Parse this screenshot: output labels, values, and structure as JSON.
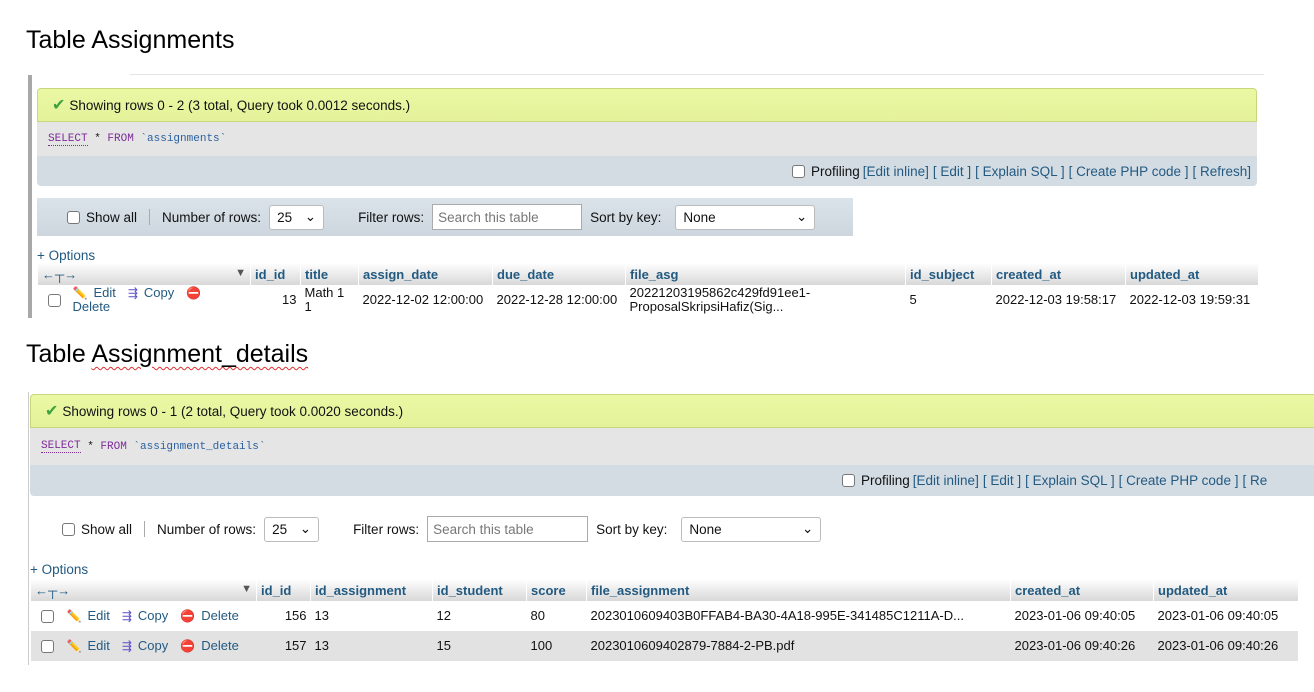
{
  "sections": [
    {
      "title": "Table Assignments",
      "success": "Showing rows 0 - 2 (3 total, Query took 0.0012 seconds.)",
      "sql": {
        "select": "SELECT",
        "star": " * ",
        "from": "FROM",
        "table": " `assignments`"
      },
      "columns": [
        "id_id",
        "title",
        "assign_date",
        "due_date",
        "file_asg",
        "id_subject",
        "created_at",
        "updated_at"
      ],
      "rows": [
        [
          "13",
          "Math 1 1",
          "2022-12-02 12:00:00",
          "2022-12-28 12:00:00",
          "20221203195862c429fd91ee1-ProposalSkripsiHafiz(Sig...",
          "5",
          "2022-12-03 19:58:17",
          "2022-12-03 19:59:31"
        ]
      ]
    },
    {
      "title_a": "Table ",
      "title_b": "Assignment_details",
      "success": "Showing rows 0 - 1 (2 total, Query took 0.0020 seconds.)",
      "sql": {
        "select": "SELECT",
        "star": " * ",
        "from": "FROM",
        "table": " `assignment_details`"
      },
      "columns": [
        "id_id",
        "id_assignment",
        "id_student",
        "score",
        "file_assignment",
        "created_at",
        "updated_at"
      ],
      "rows": [
        [
          "156",
          "13",
          "12",
          "80",
          "2023010609403B0FFAB4-BA30-4A18-995E-341485C1211A-D...",
          "2023-01-06 09:40:05",
          "2023-01-06 09:40:05"
        ],
        [
          "157",
          "13",
          "15",
          "100",
          "2023010609402879-7884-2-PB.pdf",
          "2023-01-06 09:40:26",
          "2023-01-06 09:40:26"
        ]
      ]
    }
  ],
  "profiling": {
    "label": "Profiling",
    "links": [
      "[Edit inline]",
      "[ Edit ]",
      "[ Explain SQL ]",
      "[ Create PHP code ]",
      "[ Refresh]"
    ],
    "links2": [
      "[Edit inline]",
      "[ Edit ]",
      "[ Explain SQL ]",
      "[ Create PHP code ]",
      "[ Re"
    ]
  },
  "nav": {
    "show_all": "Show all",
    "num_rows_label": "Number of rows:",
    "num_rows": "25",
    "filter_label": "Filter rows:",
    "filter_placeholder": "Search this table",
    "sort_label": "Sort by key:",
    "sort_value": "None"
  },
  "options": "+ Options",
  "row_actions": {
    "edit": "Edit",
    "copy": "Copy",
    "delete": "Delete"
  },
  "colors": {
    "success_bg": "#ebf8a4",
    "link": "#235a81",
    "panel": "#d3dce3"
  }
}
